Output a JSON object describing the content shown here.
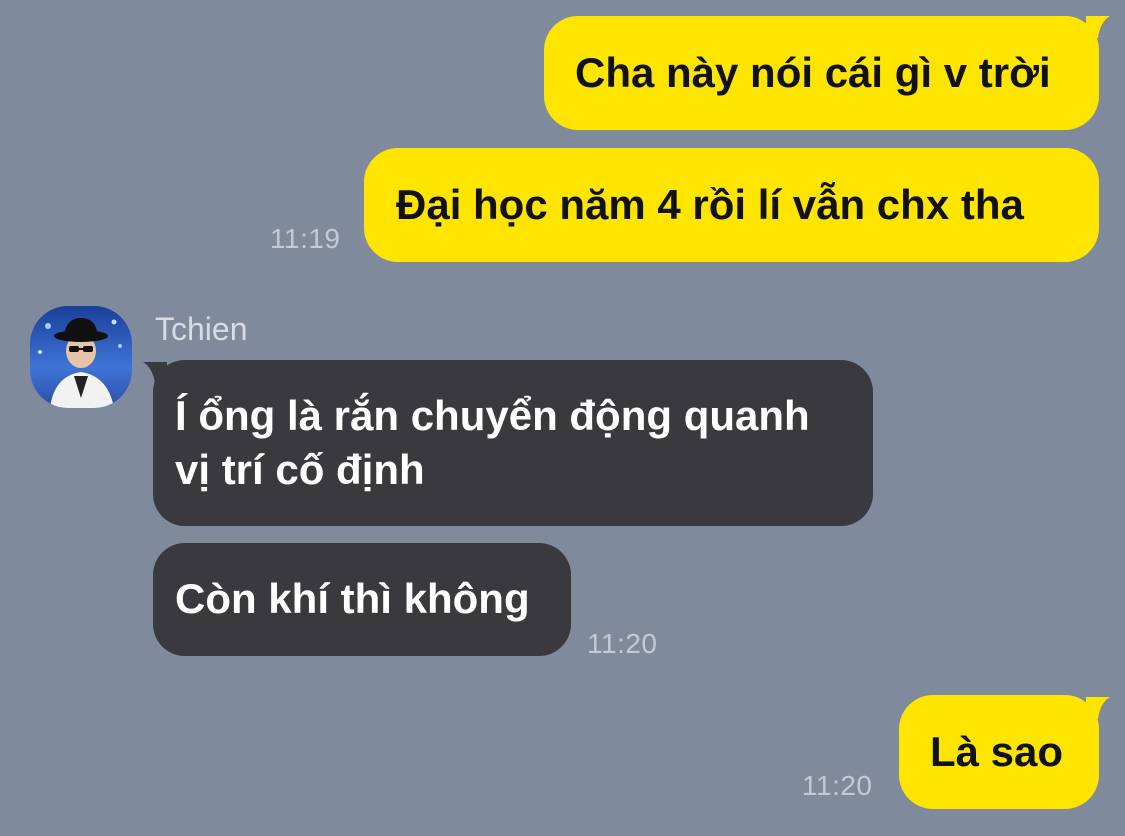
{
  "conversation": {
    "messages": [
      {
        "direction": "outgoing",
        "text": "Cha này nói cái gì v trời"
      },
      {
        "direction": "outgoing",
        "text": "Đại học năm 4 rồi lí vẫn chx tha",
        "time": "11:19"
      },
      {
        "direction": "incoming",
        "sender": "Tchien",
        "lines": [
          "Í ổng là rắn chuyển động quanh",
          "vị trí cố định"
        ]
      },
      {
        "direction": "incoming",
        "text": "Còn khí thì không",
        "time": "11:20"
      },
      {
        "direction": "outgoing",
        "text": "Là sao",
        "time": "11:20"
      }
    ]
  },
  "colors": {
    "background": "#7f8a9c",
    "outgoing_bubble": "#fee500",
    "incoming_bubble": "#3a3a3e",
    "timestamp": "#c3cad6"
  },
  "icons": {
    "avatar": "profile-avatar-photo"
  }
}
